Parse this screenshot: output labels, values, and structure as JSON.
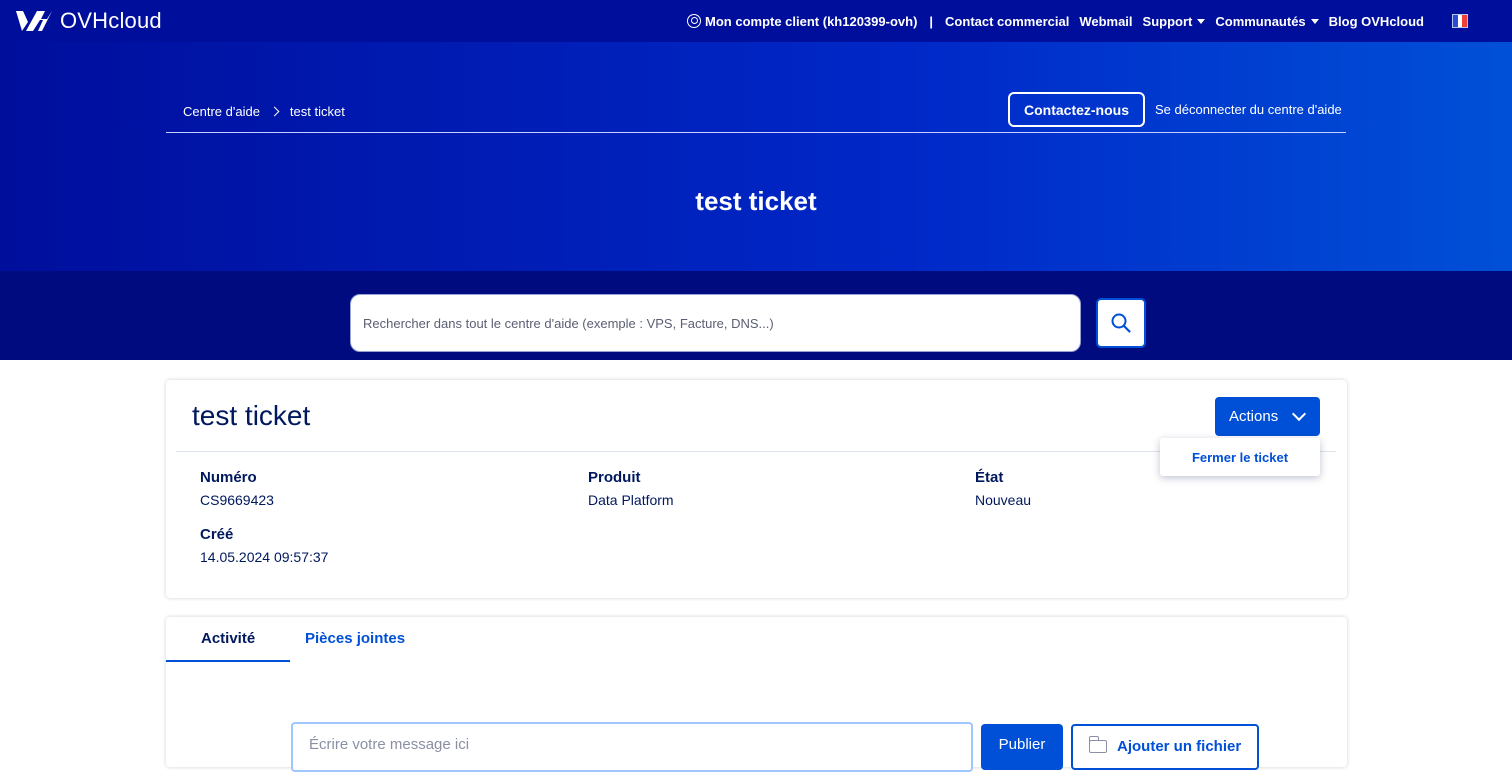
{
  "brand": {
    "name": "OVHcloud"
  },
  "topnav": {
    "account": "Mon compte client (kh120399-ovh)",
    "separator": "|",
    "contact": "Contact commercial",
    "webmail": "Webmail",
    "support": "Support",
    "communities": "Communautés",
    "blog": "Blog OVHcloud",
    "language_flag": "FR"
  },
  "hero": {
    "breadcrumb": [
      "Centre d'aide",
      "test ticket"
    ],
    "contact_button": "Contactez-nous",
    "logout_link": "Se déconnecter du centre d'aide",
    "title": "test ticket"
  },
  "search": {
    "placeholder": "Rechercher dans tout le centre d'aide (exemple : VPS, Facture, DNS...)"
  },
  "ticket": {
    "title": "test ticket",
    "actions_label": "Actions",
    "actions_menu": [
      "Fermer le ticket"
    ],
    "fields": {
      "number": {
        "label": "Numéro",
        "value": "CS9669423"
      },
      "product": {
        "label": "Produit",
        "value": "Data Platform"
      },
      "state": {
        "label": "État",
        "value": "Nouveau"
      },
      "created": {
        "label": "Créé",
        "value": "14.05.2024 09:57:37"
      }
    }
  },
  "activity": {
    "tabs": [
      "Activité",
      "Pièces jointes"
    ],
    "message_placeholder": "Écrire votre message ici",
    "publish_button": "Publier",
    "attach_button": "Ajouter un fichier"
  },
  "colors": {
    "nav_bg": "#000e9c",
    "accent": "#0050d7",
    "text_dark": "#00185e"
  }
}
